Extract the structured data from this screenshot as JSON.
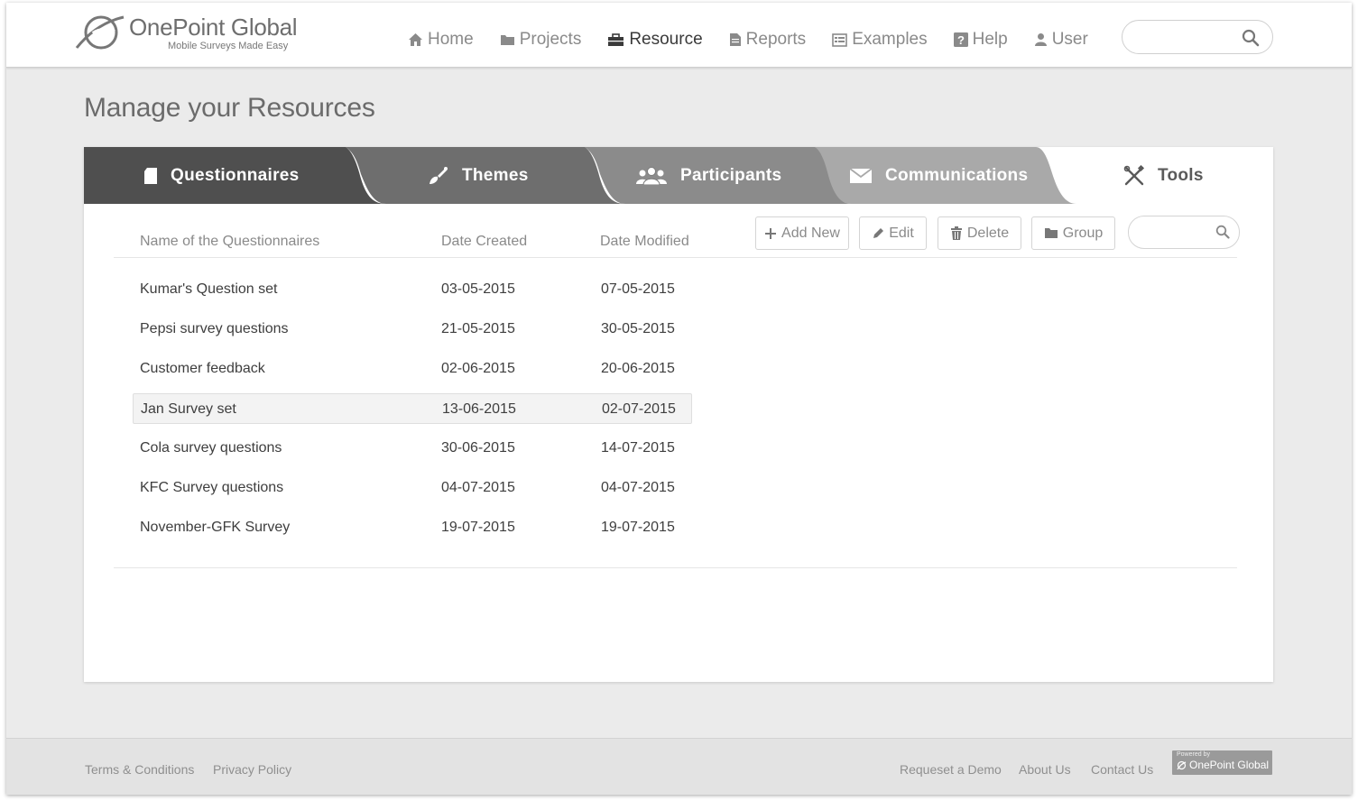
{
  "brand": {
    "name": "OnePoint Global",
    "tagline": "Mobile Surveys Made Easy"
  },
  "nav": [
    {
      "label": "Home",
      "icon": "home-icon",
      "active": false
    },
    {
      "label": "Projects",
      "icon": "folder-icon",
      "active": false
    },
    {
      "label": "Resource",
      "icon": "briefcase-icon",
      "active": true
    },
    {
      "label": "Reports",
      "icon": "document-icon",
      "active": false
    },
    {
      "label": "Examples",
      "icon": "list-icon",
      "active": false
    },
    {
      "label": "Help",
      "icon": "question-icon",
      "active": false
    },
    {
      "label": "User",
      "icon": "user-icon",
      "active": false
    }
  ],
  "search": {
    "placeholder": ""
  },
  "page": {
    "title": "Manage your Resources"
  },
  "tabs": [
    {
      "label": "Questionnaires",
      "icon": "document-icon",
      "active": true
    },
    {
      "label": "Themes",
      "icon": "brush-icon",
      "active": false
    },
    {
      "label": "Participants",
      "icon": "users-icon",
      "active": false
    },
    {
      "label": "Communications",
      "icon": "envelope-icon",
      "active": false
    },
    {
      "label": "Tools",
      "icon": "tools-icon",
      "active": false
    }
  ],
  "table": {
    "columns": [
      "Name of the Questionnaires",
      "Date Created",
      "Date Modified"
    ],
    "rows": [
      {
        "name": "Kumar's Question set",
        "created": "03-05-2015",
        "modified": "07-05-2015",
        "selected": false
      },
      {
        "name": "Pepsi survey questions",
        "created": "21-05-2015",
        "modified": "30-05-2015",
        "selected": false
      },
      {
        "name": "Customer feedback",
        "created": "02-06-2015",
        "modified": "20-06-2015",
        "selected": false
      },
      {
        "name": "Jan Survey set",
        "created": "13-06-2015",
        "modified": "02-07-2015",
        "selected": true
      },
      {
        "name": "Cola survey questions",
        "created": "30-06-2015",
        "modified": "14-07-2015",
        "selected": false
      },
      {
        "name": "KFC Survey questions",
        "created": "04-07-2015",
        "modified": "04-07-2015",
        "selected": false
      },
      {
        "name": "November-GFK Survey",
        "created": "19-07-2015",
        "modified": "19-07-2015",
        "selected": false
      }
    ]
  },
  "actions": {
    "add": "Add New",
    "edit": "Edit",
    "delete": "Delete",
    "group": "Group"
  },
  "footer": {
    "terms": "Terms & Conditions",
    "privacy": "Privacy Policy",
    "demo": "Requeset a Demo",
    "about": "About Us",
    "contact": "Contact Us",
    "powered_by": "Powered by",
    "powered_name": "OnePoint Global"
  },
  "colors": {
    "tab_active": "#4f4f4f",
    "tab_2": "#6e6e6e",
    "tab_3": "#8b8b8b",
    "tab_4": "#a9a9a9",
    "tab_inactive": "#ffffff"
  }
}
